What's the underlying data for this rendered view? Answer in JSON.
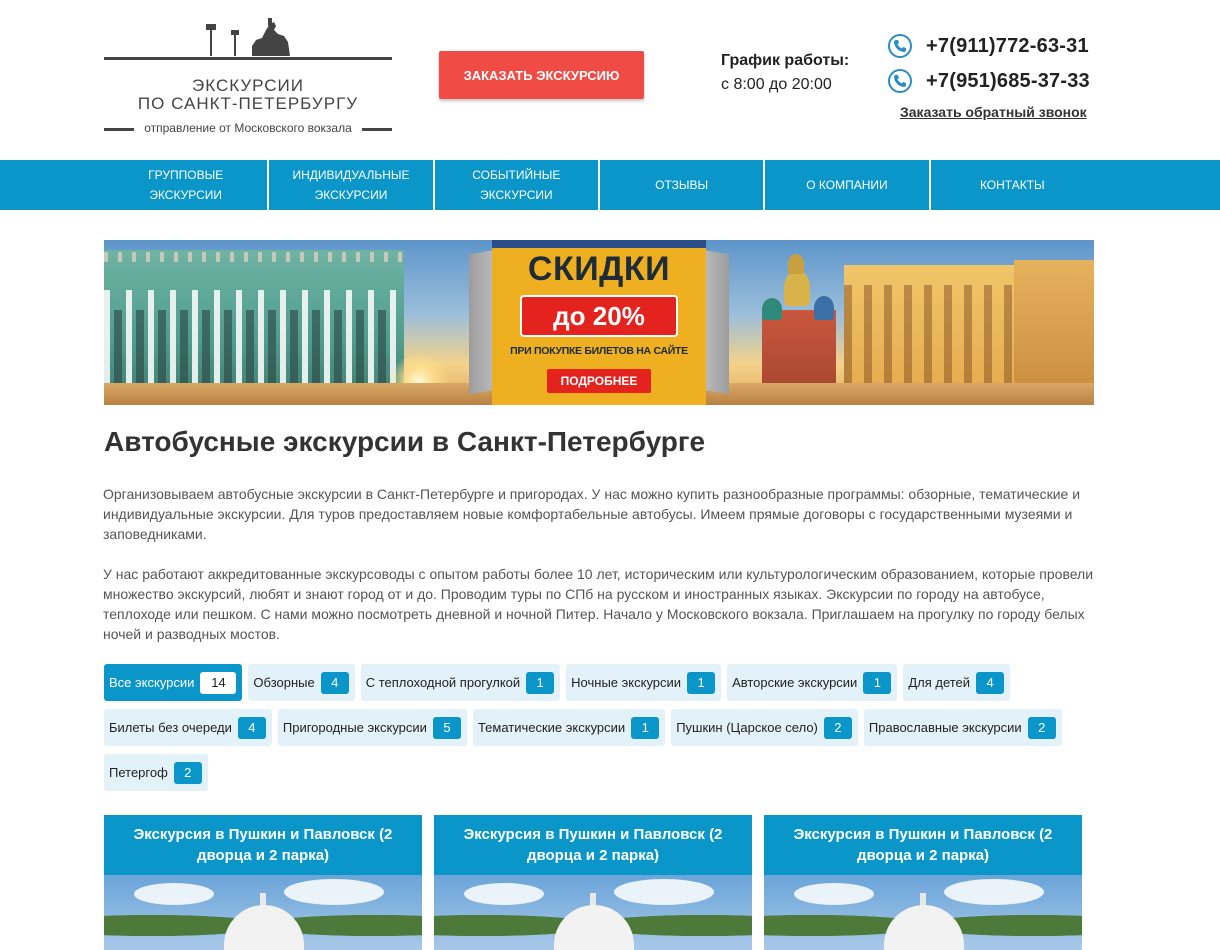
{
  "header": {
    "logo": {
      "title_line1": "ЭКСКУРСИИ",
      "title_line2": "ПО САНКТ-ПЕТЕРБУРГУ",
      "subtitle": "отправление от Московского вокзала"
    },
    "order_button": "ЗАКАЗАТЬ ЭКСКУРСИЮ",
    "schedule": {
      "title": "График работы:",
      "time": "с 8:00 до 20:00"
    },
    "phones": [
      "+7(911)772-63-31",
      "+7(951)685-37-33"
    ],
    "callback_link": "Заказать обратный звонок"
  },
  "nav": {
    "items": [
      {
        "line1": "ГРУППОВЫЕ",
        "line2": "ЭКСКУРСИИ"
      },
      {
        "line1": "ИНДИВИДУАЛЬНЫЕ",
        "line2": "ЭКСКУРСИИ"
      },
      {
        "line1": "СОБЫТИЙНЫЕ",
        "line2": "ЭКСКУРСИИ"
      },
      {
        "line1": "ОТЗЫВЫ",
        "line2": ""
      },
      {
        "line1": "О КОМПАНИИ",
        "line2": ""
      },
      {
        "line1": "КОНТАКТЫ",
        "line2": ""
      }
    ]
  },
  "banner": {
    "title": "СКИДКИ",
    "discount": "до 20%",
    "note": "ПРИ ПОКУПКЕ БИЛЕТОВ НА САЙТЕ",
    "more_button": "ПОДРОБНЕЕ"
  },
  "main": {
    "title": "Автобусные экскурсии в Санкт-Петербурге",
    "paragraph1": "Организовываем автобусные экскурсии в Санкт-Петербурге и пригородах. У нас можно купить разнообразные программы: обзорные, тематические и индивидуальные экскурсии. Для туров предоставляем новые комфортабельные автобусы. Имеем прямые договоры с государственными музеями и заповедниками.",
    "paragraph2": "У нас работают аккредитованные экскурсоводы с опытом работы более 10 лет, историческим или культурологическим образованием, которые провели множество экскурсий, любят и знают город от и до. Проводим туры по СПб на русском и иностранных языках. Экскурсии по городу на автобусе, теплоходе или пешком. С нами можно посмотреть дневной и ночной Питер. Начало у Московского вокзала. Приглашаем на прогулку по городу белых ночей и разводных мостов."
  },
  "filters": {
    "rows": [
      [
        {
          "label": "Все экскурсии",
          "count": "14",
          "active": true
        },
        {
          "label": "Обзорные",
          "count": "4"
        },
        {
          "label": "С теплоходной прогулкой",
          "count": "1"
        },
        {
          "label": "Ночные экскурсии",
          "count": "1"
        },
        {
          "label": "Авторские экскурсии",
          "count": "1"
        },
        {
          "label": "Для детей",
          "count": "4"
        }
      ],
      [
        {
          "label": "Билеты без очереди",
          "count": "4"
        },
        {
          "label": "Пригородные экскурсии",
          "count": "5"
        },
        {
          "label": "Тематические экскурсии",
          "count": "1"
        },
        {
          "label": "Пушкин (Царское село)",
          "count": "2"
        },
        {
          "label": "Православные экскурсии",
          "count": "2"
        }
      ],
      [
        {
          "label": "Петергоф",
          "count": "2"
        }
      ]
    ]
  },
  "cards": [
    {
      "title": "Экскурсия в Пушкин и Павловск (2 дворца и 2 парка)"
    },
    {
      "title": "Экскурсия в Пушкин и Павловск (2 дворца и 2 парка)"
    },
    {
      "title": "Экскурсия в Пушкин и Павловск (2 дворца и 2 парка)"
    }
  ],
  "colors": {
    "accent_blue": "#0a96c8",
    "order_red": "#f04b45",
    "promo_yellow": "#eeb020",
    "chip_bg": "#e3f1f8"
  },
  "icons": {
    "phone": "phone-icon",
    "logo": "city-skyline-logo-icon"
  }
}
